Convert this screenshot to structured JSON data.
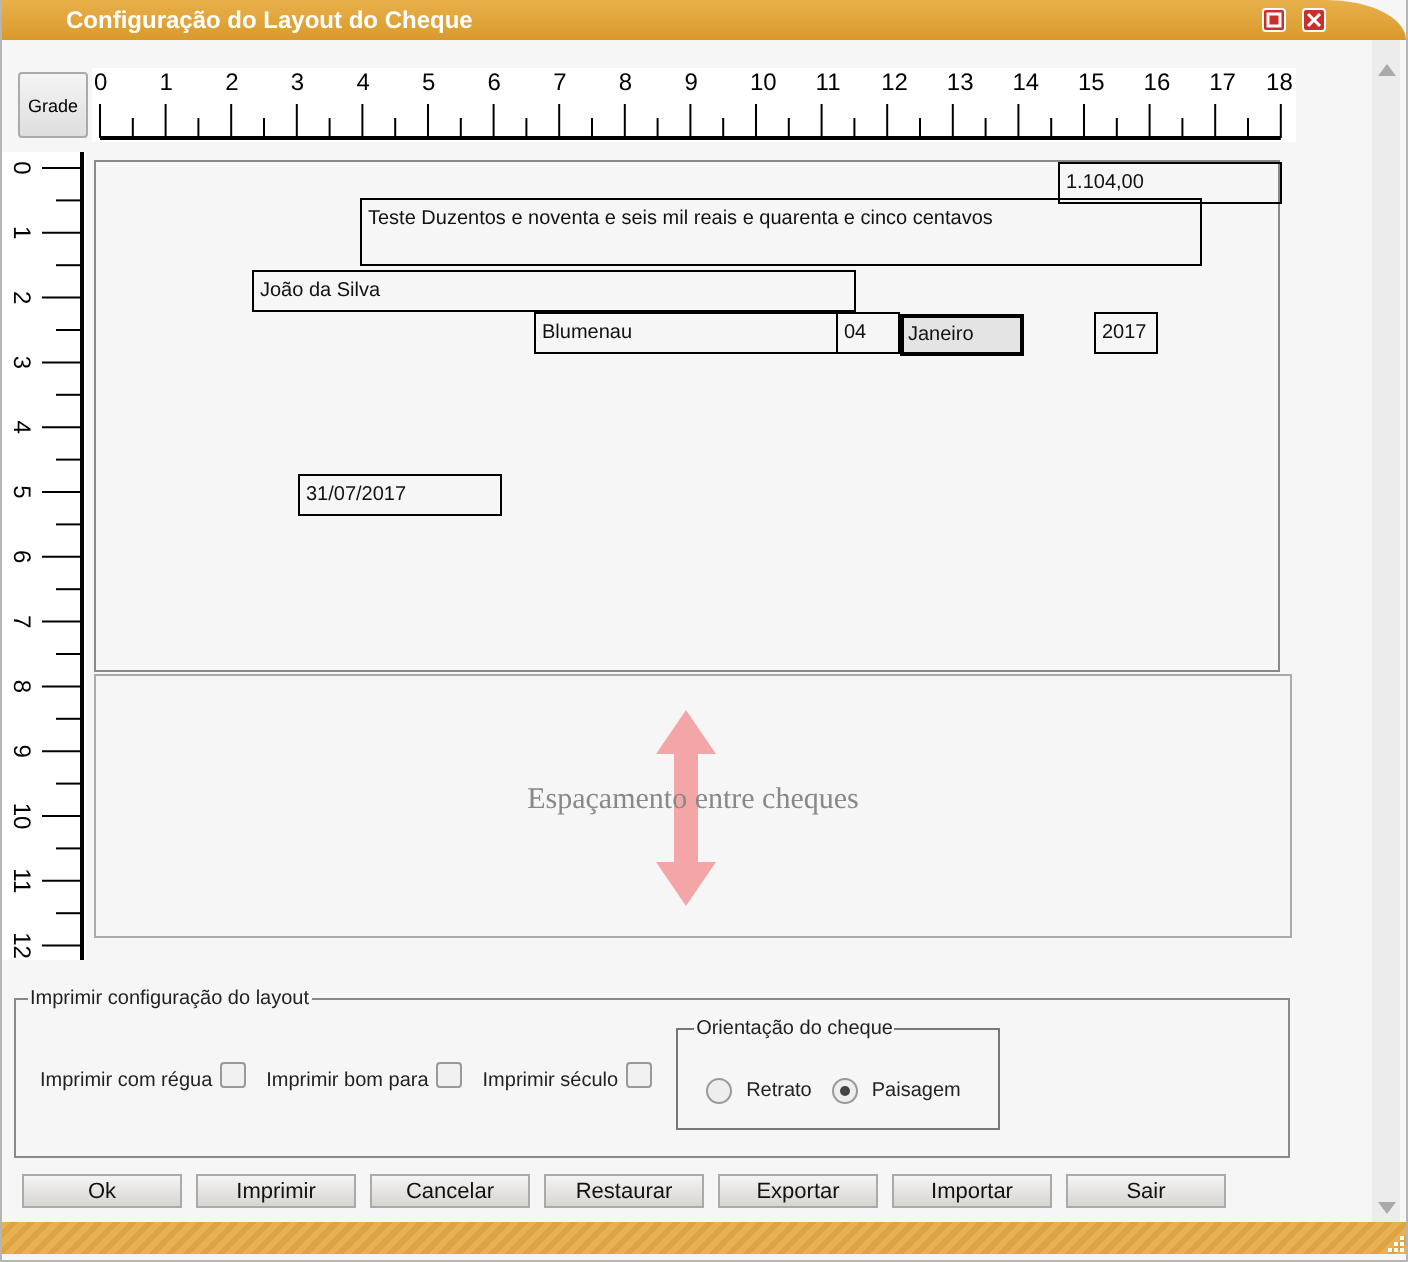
{
  "window": {
    "title": "Configuração do Layout do Cheque"
  },
  "grid_button": "Grade",
  "ruler": {
    "horizontal": [
      "0",
      "1",
      "2",
      "3",
      "4",
      "5",
      "6",
      "7",
      "8",
      "9",
      "10",
      "11",
      "12",
      "13",
      "14",
      "15",
      "16",
      "17",
      "18"
    ],
    "vertical": [
      "0",
      "1",
      "2",
      "3",
      "4",
      "5",
      "6",
      "7",
      "8",
      "9",
      "10",
      "11",
      "12"
    ]
  },
  "check_fields": [
    {
      "text": "1.104,00",
      "selected": false
    },
    {
      "text": "Teste Duzentos e noventa e seis mil reais e quarenta e cinco centavos",
      "selected": false
    },
    {
      "text": "João da Silva",
      "selected": false
    },
    {
      "text": "Blumenau",
      "selected": false
    },
    {
      "text": "04",
      "selected": false
    },
    {
      "text": "Janeiro",
      "selected": true
    },
    {
      "text": "2017",
      "selected": false
    },
    {
      "text": "31/07/2017",
      "selected": false
    }
  ],
  "spacing_label": "Espaçamento entre cheques",
  "print_settings": {
    "legend": "Imprimir configuração do layout",
    "options": [
      {
        "label": "Imprimir com régua",
        "checked": false
      },
      {
        "label": "Imprimir bom para",
        "checked": false
      },
      {
        "label": "Imprimir século",
        "checked": false
      }
    ],
    "orientation": {
      "legend": "Orientação do cheque",
      "options": [
        {
          "label": "Retrato",
          "selected": false
        },
        {
          "label": "Paisagem",
          "selected": true
        }
      ]
    }
  },
  "buttons": [
    "Ok",
    "Imprimir",
    "Cancelar",
    "Restaurar",
    "Exportar",
    "Importar",
    "Sair"
  ]
}
